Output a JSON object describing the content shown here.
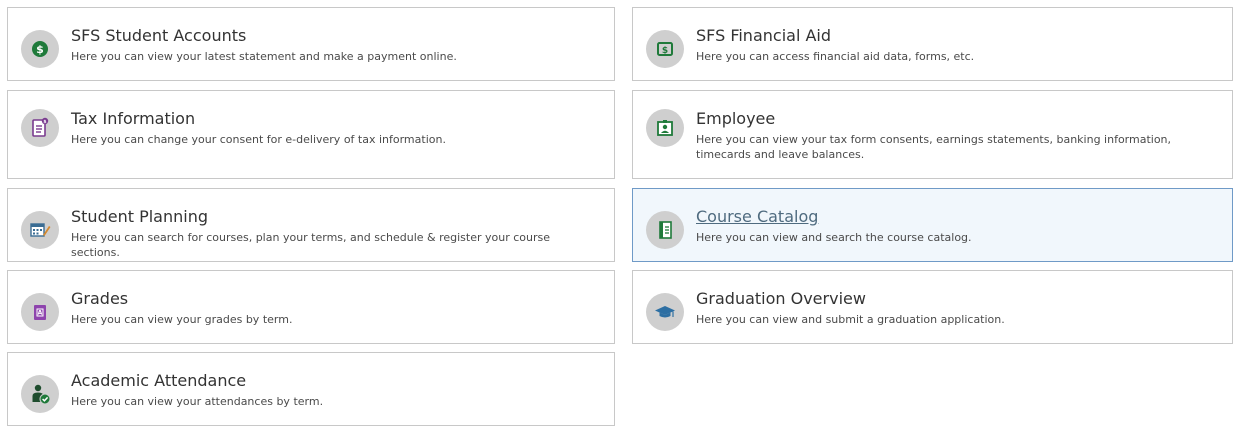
{
  "colors": {
    "accent_green": "#1f7a3a",
    "icon_bg": "#cfcfcf",
    "border": "#c8c8c8",
    "hover_bg": "#f1f7fc",
    "hover_border": "#6f9ac7",
    "grades_purple": "#8e44ad"
  },
  "tiles": [
    {
      "title": "SFS Student Accounts",
      "desc": "Here you can view your latest statement and make a payment online.",
      "icon": "dollar-coin-icon"
    },
    {
      "title": "SFS Financial Aid",
      "desc": "Here you can access financial aid data, forms, etc.",
      "icon": "dollar-bill-icon"
    },
    {
      "title": "Tax Information",
      "desc": "Here you can change your consent for e-delivery of tax information.",
      "icon": "tax-document-icon"
    },
    {
      "title": "Employee",
      "desc": "Here you can view your tax form consents, earnings statements, banking information, timecards and leave balances.",
      "icon": "employee-badge-icon"
    },
    {
      "title": "Student Planning",
      "desc": "Here you can search for courses, plan your terms, and schedule & register your course sections.",
      "icon": "calendar-pencil-icon"
    },
    {
      "title": "Course Catalog",
      "desc": "Here you can view and search the course catalog.",
      "icon": "catalog-book-icon"
    },
    {
      "title": "Grades",
      "desc": "Here you can view your grades by term.",
      "icon": "grades-book-icon"
    },
    {
      "title": "Graduation Overview",
      "desc": "Here you can view and submit a graduation application.",
      "icon": "graduation-cap-icon"
    },
    {
      "title": "Academic Attendance",
      "desc": "Here you can view your attendances by term.",
      "icon": "attendance-person-check-icon"
    }
  ]
}
